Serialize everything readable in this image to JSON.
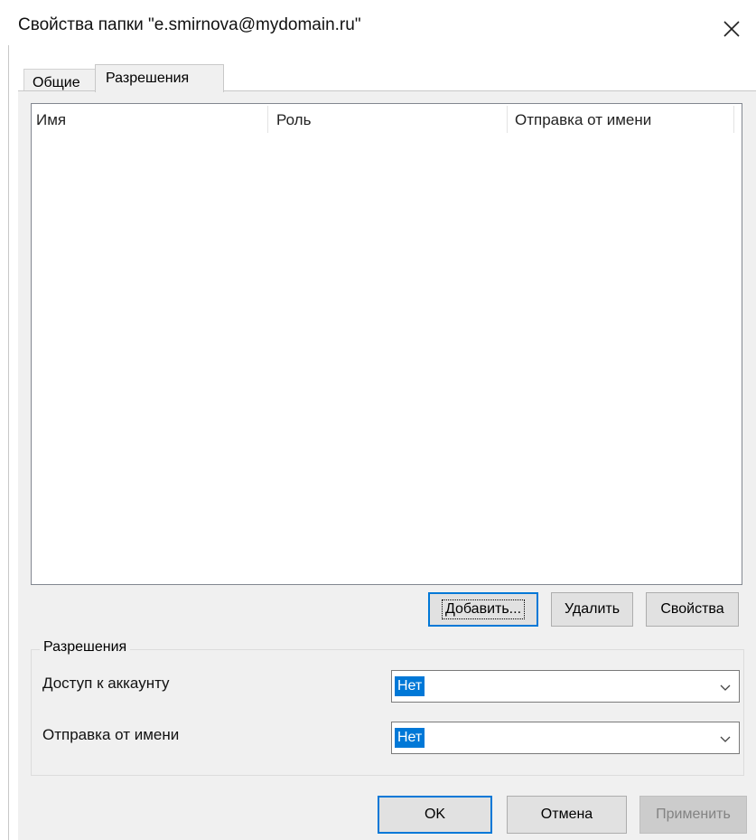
{
  "window": {
    "title": "Свойства папки \"e.smirnova@mydomain.ru\"",
    "close_icon": "close-icon"
  },
  "tabs": [
    {
      "label": "Общие",
      "selected": false
    },
    {
      "label": "Разрешения",
      "selected": true
    }
  ],
  "permissions_list": {
    "columns": [
      "Имя",
      "Роль",
      "Отправка от имени"
    ],
    "rows": []
  },
  "list_buttons": {
    "add": "Добавить...",
    "remove": "Удалить",
    "properties": "Свойства"
  },
  "permissions_group": {
    "legend": "Разрешения",
    "account_access": {
      "label": "Доступ к аккаунту",
      "value": "Нет"
    },
    "send_as": {
      "label": "Отправка от имени",
      "value": "Нет"
    }
  },
  "footer": {
    "ok": "OK",
    "cancel": "Отмена",
    "apply": "Применить",
    "apply_enabled": false
  },
  "colors": {
    "accent": "#0078d7",
    "panel": "#f0f0f0",
    "button": "#e1e1e1"
  }
}
